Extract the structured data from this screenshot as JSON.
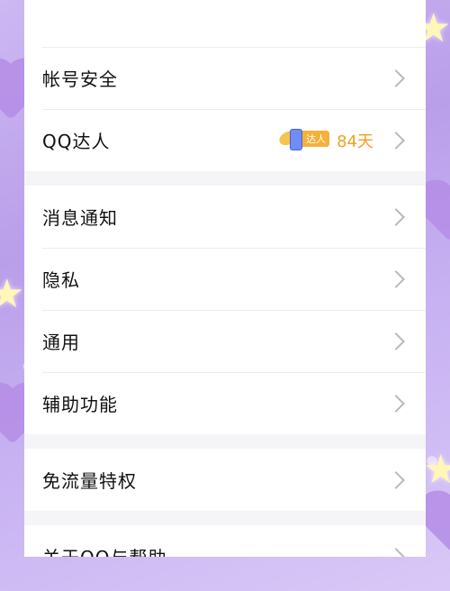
{
  "settings": {
    "account_security": "帐号安全",
    "qq_daren": "QQ达人",
    "daren_badge_text": "达人",
    "daren_days": "84天",
    "notifications": "消息通知",
    "privacy": "隐私",
    "general": "通用",
    "accessibility": "辅助功能",
    "data_privilege": "免流量特权",
    "about_help": "关于QQ与帮助"
  },
  "colors": {
    "accent_orange": "#f0a021",
    "chevron": "#b8b8bd"
  }
}
